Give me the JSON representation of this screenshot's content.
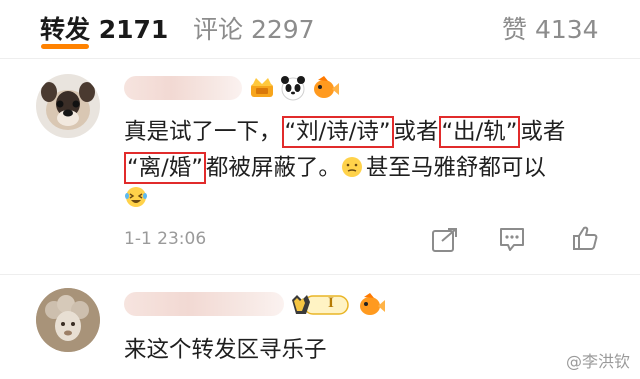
{
  "tabs": {
    "repost": {
      "label": "转发",
      "count": "2171"
    },
    "comment": {
      "label": "评论",
      "count": "2297"
    },
    "like": {
      "label": "赞",
      "count": "4134"
    }
  },
  "comments": [
    {
      "line1": [
        "真是试了一下，",
        "“刘/诗/诗”",
        "或者",
        "“出/轨”",
        "或者"
      ],
      "line2": [
        "“离/婚”",
        "都被屏蔽了。",
        "甚至马雅舒都可以"
      ],
      "time": "1-1 23:06"
    },
    {
      "text": "来这个转发区寻乐子",
      "badge_text": "I"
    }
  ],
  "watermark": "@李洪钦",
  "colors": {
    "accent": "#ff8200",
    "highlight_box": "#e12b2b"
  }
}
